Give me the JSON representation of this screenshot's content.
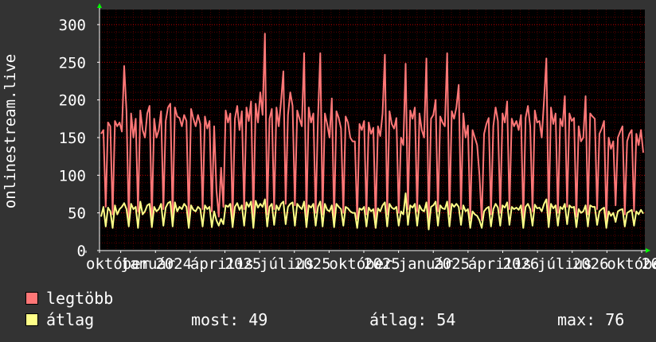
{
  "chart_data": {
    "type": "line",
    "ylabel": "onlinestream.live",
    "ylim": [
      0,
      320
    ],
    "yticks": [
      0,
      50,
      100,
      150,
      200,
      250,
      300
    ],
    "xtick_labels": [
      "október",
      "január",
      "2024",
      "április",
      "2025",
      "július",
      "2025",
      "október",
      "2025",
      "január",
      "2025",
      "április",
      "2026",
      "július",
      "2026",
      "október",
      "20"
    ],
    "grid": true,
    "series": [
      {
        "name": "legtöbb",
        "color": "#ff7777",
        "values": [
          155,
          160,
          58,
          170,
          165,
          48,
          172,
          165,
          170,
          158,
          245,
          185,
          40,
          182,
          150,
          175,
          52,
          186,
          160,
          150,
          182,
          192,
          42,
          175,
          150,
          160,
          185,
          55,
          172,
          190,
          195,
          45,
          190,
          178,
          176,
          165,
          180,
          172,
          40,
          188,
          175,
          165,
          180,
          168,
          55,
          178,
          162,
          172,
          52,
          165,
          80,
          45,
          110,
          58,
          186,
          170,
          182,
          42,
          175,
          192,
          160,
          185,
          55,
          190,
          172,
          198,
          45,
          195,
          170,
          210,
          180,
          288,
          48,
          175,
          188,
          55,
          190,
          165,
          198,
          238,
          62,
          180,
          210,
          192,
          60,
          186,
          175,
          165,
          262,
          45,
          190,
          170,
          182,
          50,
          175,
          262,
          48,
          182,
          168,
          150,
          202,
          40,
          185,
          176,
          162,
          50,
          178,
          170,
          150,
          145,
          145,
          42,
          168,
          160,
          172,
          48,
          170,
          155,
          163,
          40,
          165,
          152,
          182,
          260,
          48,
          185,
          168,
          162,
          176,
          50,
          150,
          140,
          248,
          55,
          186,
          175,
          190,
          52,
          182,
          160,
          150,
          255,
          40,
          175,
          180,
          200,
          52,
          178,
          170,
          165,
          262,
          48,
          185,
          175,
          190,
          220,
          55,
          182,
          150,
          166,
          42,
          160,
          150,
          140,
          100,
          40,
          155,
          168,
          176,
          48,
          165,
          190,
          172,
          50,
          182,
          170,
          198,
          55,
          175,
          165,
          172,
          160,
          180,
          40,
          176,
          192,
          165,
          52,
          186,
          170,
          172,
          150,
          200,
          255,
          45,
          190,
          168,
          182,
          50,
          175,
          165,
          205,
          58,
          182,
          172,
          176,
          45,
          165,
          145,
          150,
          205,
          48,
          182,
          178,
          175,
          55,
          155,
          162,
          172,
          40,
          150,
          135,
          145,
          60,
          150,
          158,
          165,
          48,
          145,
          155,
          160,
          52,
          155,
          140,
          160,
          130
        ]
      },
      {
        "name": "átlag",
        "color": "#ffff88",
        "values": [
          45,
          58,
          32,
          57,
          52,
          30,
          60,
          48,
          55,
          58,
          63,
          55,
          32,
          62,
          55,
          58,
          30,
          65,
          48,
          52,
          60,
          62,
          31,
          58,
          52,
          55,
          62,
          33,
          57,
          63,
          65,
          32,
          64,
          52,
          58,
          55,
          62,
          58,
          30,
          60,
          54,
          52,
          58,
          55,
          32,
          60,
          55,
          58,
          31,
          52,
          40,
          33,
          42,
          35,
          60,
          58,
          62,
          31,
          58,
          63,
          54,
          60,
          33,
          64,
          58,
          65,
          30,
          66,
          57,
          62,
          58,
          68,
          32,
          58,
          62,
          34,
          60,
          54,
          62,
          65,
          35,
          58,
          62,
          64,
          33,
          62,
          58,
          55,
          65,
          31,
          60,
          57,
          62,
          33,
          58,
          65,
          32,
          62,
          54,
          52,
          60,
          31,
          62,
          58,
          55,
          33,
          58,
          56,
          52,
          50,
          50,
          30,
          56,
          54,
          58,
          32,
          57,
          52,
          55,
          30,
          56,
          52,
          60,
          64,
          32,
          62,
          57,
          55,
          58,
          33,
          52,
          48,
          76,
          34,
          60,
          57,
          62,
          33,
          60,
          54,
          52,
          64,
          28,
          58,
          60,
          65,
          33,
          60,
          56,
          55,
          65,
          32,
          62,
          58,
          62,
          58,
          34,
          60,
          52,
          55,
          30,
          52,
          48,
          46,
          40,
          30,
          52,
          56,
          58,
          32,
          55,
          62,
          57,
          33,
          60,
          57,
          64,
          34,
          58,
          55,
          57,
          54,
          60,
          30,
          58,
          62,
          55,
          33,
          61,
          56,
          57,
          52,
          62,
          68,
          31,
          62,
          56,
          60,
          33,
          58,
          55,
          62,
          35,
          60,
          57,
          58,
          31,
          55,
          50,
          52,
          60,
          32,
          60,
          58,
          58,
          34,
          52,
          55,
          57,
          30,
          52,
          46,
          50,
          38,
          52,
          54,
          55,
          32,
          50,
          52,
          54,
          33,
          52,
          48,
          54,
          49
        ]
      }
    ]
  },
  "legend": {
    "items": [
      {
        "label": "legtöbb",
        "color": "#ff7777"
      },
      {
        "label": "átlag",
        "color": "#ffff88"
      }
    ],
    "stats": {
      "now": "most: 49",
      "avg": "átlag: 54",
      "max": "max: 76"
    }
  },
  "colors": {
    "background": "#333333",
    "plot_background": "#000000",
    "grid": "#ff0000",
    "axis": "#ffffff",
    "arrow": "#00ff00"
  }
}
